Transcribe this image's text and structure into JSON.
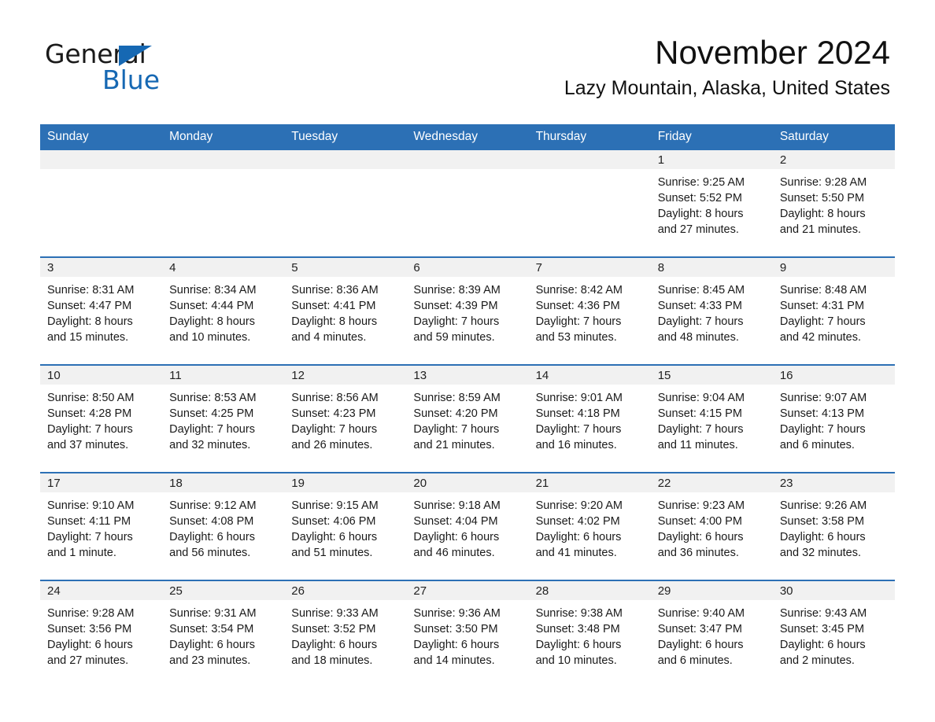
{
  "brand": {
    "name_part1": "General",
    "name_part2": "Blue",
    "triangle_color": "#1668b3",
    "accent_color": "#2c70b5"
  },
  "header": {
    "month_title": "November 2024",
    "location": "Lazy Mountain, Alaska, United States"
  },
  "calendar": {
    "weekday_headers": [
      "Sunday",
      "Monday",
      "Tuesday",
      "Wednesday",
      "Thursday",
      "Friday",
      "Saturday"
    ],
    "weeks": [
      [
        {
          "day": "",
          "lines": []
        },
        {
          "day": "",
          "lines": []
        },
        {
          "day": "",
          "lines": []
        },
        {
          "day": "",
          "lines": []
        },
        {
          "day": "",
          "lines": []
        },
        {
          "day": "1",
          "lines": [
            "Sunrise: 9:25 AM",
            "Sunset: 5:52 PM",
            "Daylight: 8 hours",
            "and 27 minutes."
          ]
        },
        {
          "day": "2",
          "lines": [
            "Sunrise: 9:28 AM",
            "Sunset: 5:50 PM",
            "Daylight: 8 hours",
            "and 21 minutes."
          ]
        }
      ],
      [
        {
          "day": "3",
          "lines": [
            "Sunrise: 8:31 AM",
            "Sunset: 4:47 PM",
            "Daylight: 8 hours",
            "and 15 minutes."
          ]
        },
        {
          "day": "4",
          "lines": [
            "Sunrise: 8:34 AM",
            "Sunset: 4:44 PM",
            "Daylight: 8 hours",
            "and 10 minutes."
          ]
        },
        {
          "day": "5",
          "lines": [
            "Sunrise: 8:36 AM",
            "Sunset: 4:41 PM",
            "Daylight: 8 hours",
            "and 4 minutes."
          ]
        },
        {
          "day": "6",
          "lines": [
            "Sunrise: 8:39 AM",
            "Sunset: 4:39 PM",
            "Daylight: 7 hours",
            "and 59 minutes."
          ]
        },
        {
          "day": "7",
          "lines": [
            "Sunrise: 8:42 AM",
            "Sunset: 4:36 PM",
            "Daylight: 7 hours",
            "and 53 minutes."
          ]
        },
        {
          "day": "8",
          "lines": [
            "Sunrise: 8:45 AM",
            "Sunset: 4:33 PM",
            "Daylight: 7 hours",
            "and 48 minutes."
          ]
        },
        {
          "day": "9",
          "lines": [
            "Sunrise: 8:48 AM",
            "Sunset: 4:31 PM",
            "Daylight: 7 hours",
            "and 42 minutes."
          ]
        }
      ],
      [
        {
          "day": "10",
          "lines": [
            "Sunrise: 8:50 AM",
            "Sunset: 4:28 PM",
            "Daylight: 7 hours",
            "and 37 minutes."
          ]
        },
        {
          "day": "11",
          "lines": [
            "Sunrise: 8:53 AM",
            "Sunset: 4:25 PM",
            "Daylight: 7 hours",
            "and 32 minutes."
          ]
        },
        {
          "day": "12",
          "lines": [
            "Sunrise: 8:56 AM",
            "Sunset: 4:23 PM",
            "Daylight: 7 hours",
            "and 26 minutes."
          ]
        },
        {
          "day": "13",
          "lines": [
            "Sunrise: 8:59 AM",
            "Sunset: 4:20 PM",
            "Daylight: 7 hours",
            "and 21 minutes."
          ]
        },
        {
          "day": "14",
          "lines": [
            "Sunrise: 9:01 AM",
            "Sunset: 4:18 PM",
            "Daylight: 7 hours",
            "and 16 minutes."
          ]
        },
        {
          "day": "15",
          "lines": [
            "Sunrise: 9:04 AM",
            "Sunset: 4:15 PM",
            "Daylight: 7 hours",
            "and 11 minutes."
          ]
        },
        {
          "day": "16",
          "lines": [
            "Sunrise: 9:07 AM",
            "Sunset: 4:13 PM",
            "Daylight: 7 hours",
            "and 6 minutes."
          ]
        }
      ],
      [
        {
          "day": "17",
          "lines": [
            "Sunrise: 9:10 AM",
            "Sunset: 4:11 PM",
            "Daylight: 7 hours",
            "and 1 minute."
          ]
        },
        {
          "day": "18",
          "lines": [
            "Sunrise: 9:12 AM",
            "Sunset: 4:08 PM",
            "Daylight: 6 hours",
            "and 56 minutes."
          ]
        },
        {
          "day": "19",
          "lines": [
            "Sunrise: 9:15 AM",
            "Sunset: 4:06 PM",
            "Daylight: 6 hours",
            "and 51 minutes."
          ]
        },
        {
          "day": "20",
          "lines": [
            "Sunrise: 9:18 AM",
            "Sunset: 4:04 PM",
            "Daylight: 6 hours",
            "and 46 minutes."
          ]
        },
        {
          "day": "21",
          "lines": [
            "Sunrise: 9:20 AM",
            "Sunset: 4:02 PM",
            "Daylight: 6 hours",
            "and 41 minutes."
          ]
        },
        {
          "day": "22",
          "lines": [
            "Sunrise: 9:23 AM",
            "Sunset: 4:00 PM",
            "Daylight: 6 hours",
            "and 36 minutes."
          ]
        },
        {
          "day": "23",
          "lines": [
            "Sunrise: 9:26 AM",
            "Sunset: 3:58 PM",
            "Daylight: 6 hours",
            "and 32 minutes."
          ]
        }
      ],
      [
        {
          "day": "24",
          "lines": [
            "Sunrise: 9:28 AM",
            "Sunset: 3:56 PM",
            "Daylight: 6 hours",
            "and 27 minutes."
          ]
        },
        {
          "day": "25",
          "lines": [
            "Sunrise: 9:31 AM",
            "Sunset: 3:54 PM",
            "Daylight: 6 hours",
            "and 23 minutes."
          ]
        },
        {
          "day": "26",
          "lines": [
            "Sunrise: 9:33 AM",
            "Sunset: 3:52 PM",
            "Daylight: 6 hours",
            "and 18 minutes."
          ]
        },
        {
          "day": "27",
          "lines": [
            "Sunrise: 9:36 AM",
            "Sunset: 3:50 PM",
            "Daylight: 6 hours",
            "and 14 minutes."
          ]
        },
        {
          "day": "28",
          "lines": [
            "Sunrise: 9:38 AM",
            "Sunset: 3:48 PM",
            "Daylight: 6 hours",
            "and 10 minutes."
          ]
        },
        {
          "day": "29",
          "lines": [
            "Sunrise: 9:40 AM",
            "Sunset: 3:47 PM",
            "Daylight: 6 hours",
            "and 6 minutes."
          ]
        },
        {
          "day": "30",
          "lines": [
            "Sunrise: 9:43 AM",
            "Sunset: 3:45 PM",
            "Daylight: 6 hours",
            "and 2 minutes."
          ]
        }
      ]
    ]
  }
}
